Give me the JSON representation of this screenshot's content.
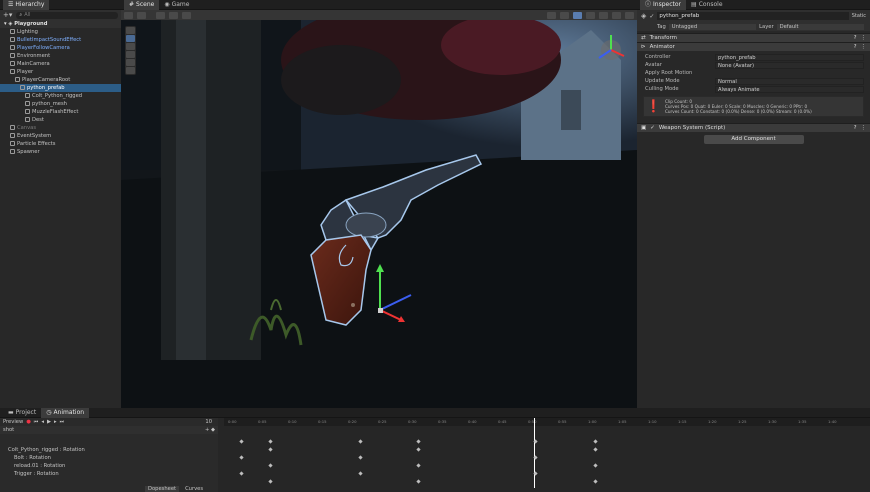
{
  "hierarchy": {
    "tab": "Hierarchy",
    "search_placeholder": "All",
    "scene": "Playground",
    "items": [
      {
        "label": "Lighting",
        "indent": 2,
        "style": "normal"
      },
      {
        "label": "BulletImpactSoundEffect",
        "indent": 2,
        "style": "blue"
      },
      {
        "label": "PlayerFollowCamera",
        "indent": 2,
        "style": "blue"
      },
      {
        "label": "Environment",
        "indent": 2,
        "style": "normal"
      },
      {
        "label": "MainCamera",
        "indent": 2,
        "style": "normal"
      },
      {
        "label": "Player",
        "indent": 2,
        "style": "normal"
      },
      {
        "label": "PlayerCameraRoot",
        "indent": 3,
        "style": "normal"
      },
      {
        "label": "python_prefab",
        "indent": 4,
        "style": "selected"
      },
      {
        "label": "Colt_Python_rigged",
        "indent": 5,
        "style": "normal"
      },
      {
        "label": "python_mesh",
        "indent": 5,
        "style": "normal"
      },
      {
        "label": "MuzzleFlashEffect",
        "indent": 5,
        "style": "normal"
      },
      {
        "label": "Dest",
        "indent": 5,
        "style": "normal"
      },
      {
        "label": "Canvas",
        "indent": 2,
        "style": "dim"
      },
      {
        "label": "EventSystem",
        "indent": 2,
        "style": "normal"
      },
      {
        "label": "Particle Effects",
        "indent": 2,
        "style": "normal"
      },
      {
        "label": "Spawner",
        "indent": 2,
        "style": "normal"
      }
    ]
  },
  "scene_tabs": {
    "scene": "Scene",
    "game": "Game"
  },
  "inspector": {
    "tab": "Inspector",
    "console_tab": "Console",
    "object_name": "python_prefab",
    "static_label": "Static",
    "tag_label": "Tag",
    "tag_value": "Untagged",
    "layer_label": "Layer",
    "layer_value": "Default",
    "transform_label": "Transform",
    "animator_label": "Animator",
    "animator_fields": [
      {
        "label": "Controller",
        "value": "python_prefab"
      },
      {
        "label": "Avatar",
        "value": "None (Avatar)"
      },
      {
        "label": "Apply Root Motion",
        "value": ""
      },
      {
        "label": "Update Mode",
        "value": "Normal"
      },
      {
        "label": "Culling Mode",
        "value": "Always Animate"
      }
    ],
    "info_lines": [
      "Clip Count: 0",
      "Curves Pos: 0 Quat: 0 Euler: 0 Scale: 0 Muscles: 0 Generic: 0 PPtr: 0",
      "Curves Count: 0 Constant: 0 (0.0%) Dense: 0 (0.0%) Stream: 0 (0.0%)"
    ],
    "script_label": "Weapon System (Script)",
    "add_component": "Add Component"
  },
  "bottom": {
    "project_tab": "Project",
    "animation_tab": "Animation",
    "preview_label": "Preview",
    "frame_value": "10",
    "clip_label": "shot",
    "tracks": [
      "Colt_Python_rigged : Rotation",
      "Bolt : Rotation",
      "reload.01 : Rotation",
      "Trigger : Rotation"
    ],
    "dopesheet_label": "Dopesheet",
    "curves_label": "Curves",
    "ruler_labels": [
      "0:00",
      "0:05",
      "0:10",
      "0:15",
      "0:20",
      "0:25",
      "0:30",
      "0:35",
      "0:40",
      "0:45",
      "0:50",
      "0:55",
      "1:00",
      "1:05",
      "1:10",
      "1:15",
      "1:20",
      "1:25",
      "1:30",
      "1:35",
      "1:40"
    ]
  },
  "colors": {
    "selection": "#2c5d87",
    "playhead": "#ffffff",
    "outline": "#a7c8ec"
  }
}
